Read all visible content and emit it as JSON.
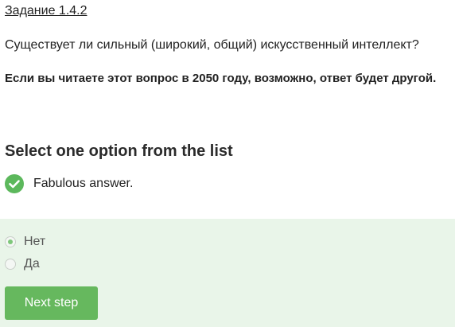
{
  "task": {
    "link_label": "Задание 1.4.2"
  },
  "question": {
    "text": "Существует ли сильный (широкий, общий) искусственный интеллект?",
    "note": "Если вы читаете этот вопрос в 2050 году, возможно, ответ будет другой."
  },
  "quiz": {
    "heading": "Select one option from the list",
    "feedback": {
      "icon": "check-circle-icon",
      "text": "Fabulous answer."
    },
    "options": [
      {
        "label": "Нет",
        "selected": true
      },
      {
        "label": "Да",
        "selected": false
      }
    ],
    "next_button_label": "Next step"
  },
  "colors": {
    "accent_green": "#66b85e",
    "success_icon": "#5cb85c",
    "panel_background": "#e9f5e9"
  }
}
